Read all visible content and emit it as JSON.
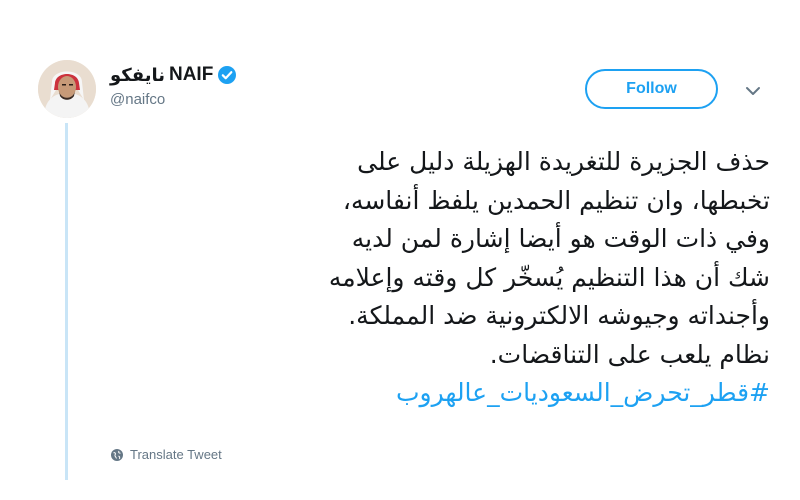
{
  "author": {
    "display_name_ar": "نايفكو",
    "display_name_en": "NAIF",
    "handle": "@naifco",
    "verified": true
  },
  "actions": {
    "follow_label": "Follow"
  },
  "tweet": {
    "lines": [
      "حذف الجزيرة للتغريدة الهزيلة دليل على",
      "تخبطها، وان تنظيم الحمدين يلفظ أنفاسه،",
      "وفي ذات الوقت هو أيضا إشارة لمن لديه",
      "شك أن هذا التنظيم يُسخّر كل وقته وإعلامه",
      "وأجنداته وجيوشه الالكترونية ضد المملكة.",
      "نظام يلعب على التناقضات."
    ],
    "hashtag": "#قطر_تحرض_السعوديات_عالهروب"
  },
  "footer": {
    "translate_label": "Translate Tweet"
  },
  "colors": {
    "accent": "#1da1f2",
    "text": "#14171a",
    "muted": "#657786",
    "thread_line": "#c9e5f7"
  },
  "icons": {
    "verified": "verified-badge-icon",
    "caret": "chevron-down-icon",
    "translate": "globe-icon"
  }
}
